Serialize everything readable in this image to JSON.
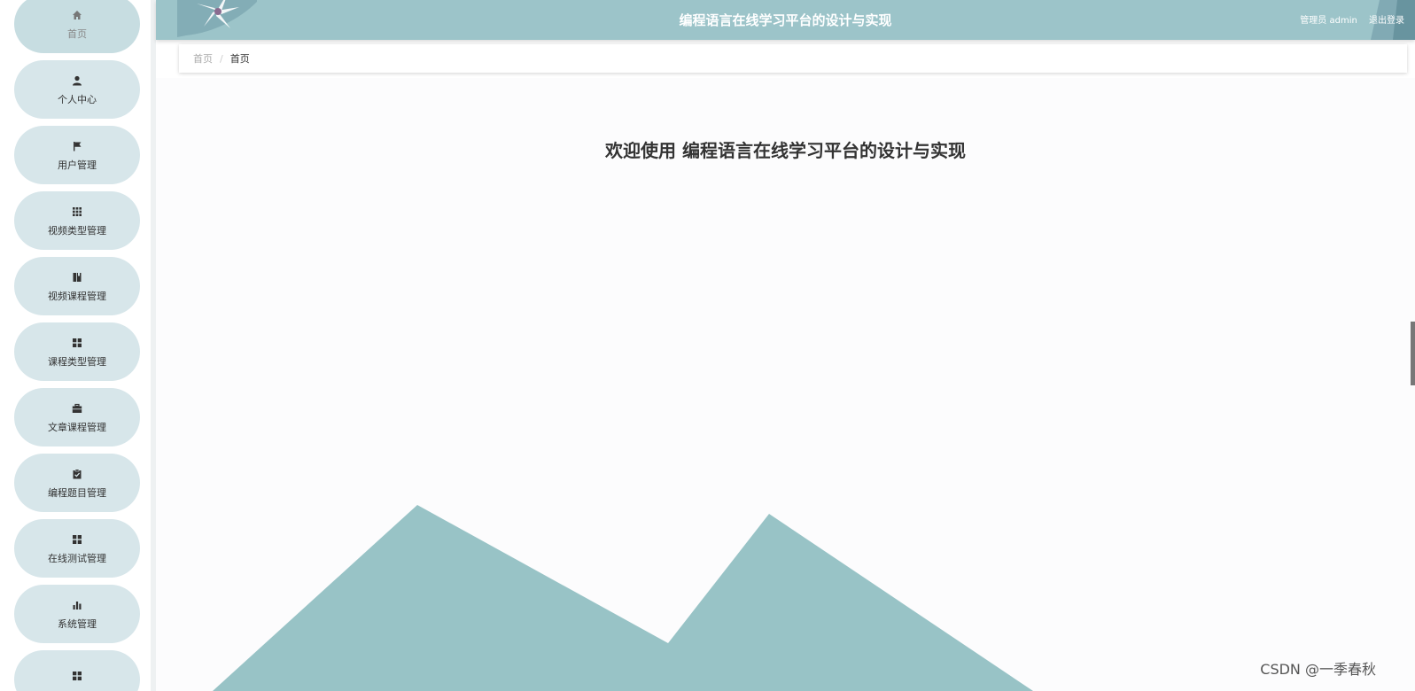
{
  "header": {
    "title": "编程语言在线学习平台的设计与实现",
    "user_label": "管理员 admin",
    "logout_label": "退出登录",
    "bg_color": "#9cc4c9"
  },
  "breadcrumb": {
    "home": "首页",
    "separator": "/",
    "current": "首页"
  },
  "main": {
    "welcome": "欢迎使用 编程语言在线学习平台的设计与实现"
  },
  "sidebar": {
    "items": [
      {
        "label": "首页",
        "icon": "home-icon"
      },
      {
        "label": "个人中心",
        "icon": "user-icon"
      },
      {
        "label": "用户管理",
        "icon": "flag-icon"
      },
      {
        "label": "视频类型管理",
        "icon": "grid-icon"
      },
      {
        "label": "视频课程管理",
        "icon": "book-icon"
      },
      {
        "label": "课程类型管理",
        "icon": "squares-icon"
      },
      {
        "label": "文章课程管理",
        "icon": "briefcase-icon"
      },
      {
        "label": "编程题目管理",
        "icon": "clipboard-icon"
      },
      {
        "label": "在线测试管理",
        "icon": "squares-icon"
      },
      {
        "label": "系统管理",
        "icon": "bar-chart-icon"
      },
      {
        "label": "",
        "icon": "squares-icon"
      }
    ]
  },
  "watermark": "CSDN @一季春秋"
}
